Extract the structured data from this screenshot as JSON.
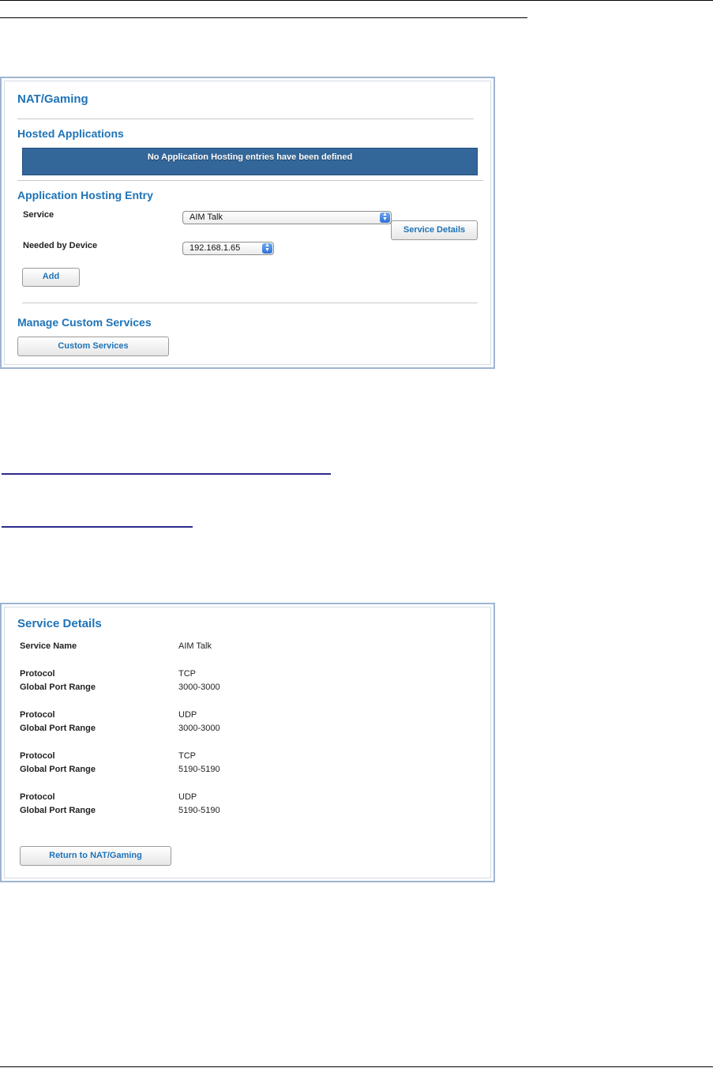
{
  "nat": {
    "title": "NAT/Gaming",
    "hosted_heading": "Hosted Applications",
    "banner": "No Application Hosting entries have been defined",
    "entry_heading": "Application Hosting Entry",
    "service_label": "Service",
    "service_value": "AIM Talk",
    "device_label": "Needed by Device",
    "device_value": "192.168.1.65",
    "service_details_button": "Service Details",
    "add_button": "Add",
    "custom_heading": "Manage Custom Services",
    "custom_button": "Custom Services"
  },
  "details": {
    "title": "Service Details",
    "service_name_label": "Service Name",
    "service_name_value": "AIM Talk",
    "entries": [
      {
        "protocol_label": "Protocol",
        "protocol": "TCP",
        "range_label": "Global Port Range",
        "range": "3000-3000"
      },
      {
        "protocol_label": "Protocol",
        "protocol": "UDP",
        "range_label": "Global Port Range",
        "range": "3000-3000"
      },
      {
        "protocol_label": "Protocol",
        "protocol": "TCP",
        "range_label": "Global Port Range",
        "range": "5190-5190"
      },
      {
        "protocol_label": "Protocol",
        "protocol": "UDP",
        "range_label": "Global Port Range",
        "range": "5190-5190"
      }
    ],
    "return_button": "Return to NAT/Gaming"
  },
  "colors": {
    "heading_blue": "#1e73b8",
    "banner_blue": "#336699",
    "panel_border": "#9fb4d2"
  }
}
